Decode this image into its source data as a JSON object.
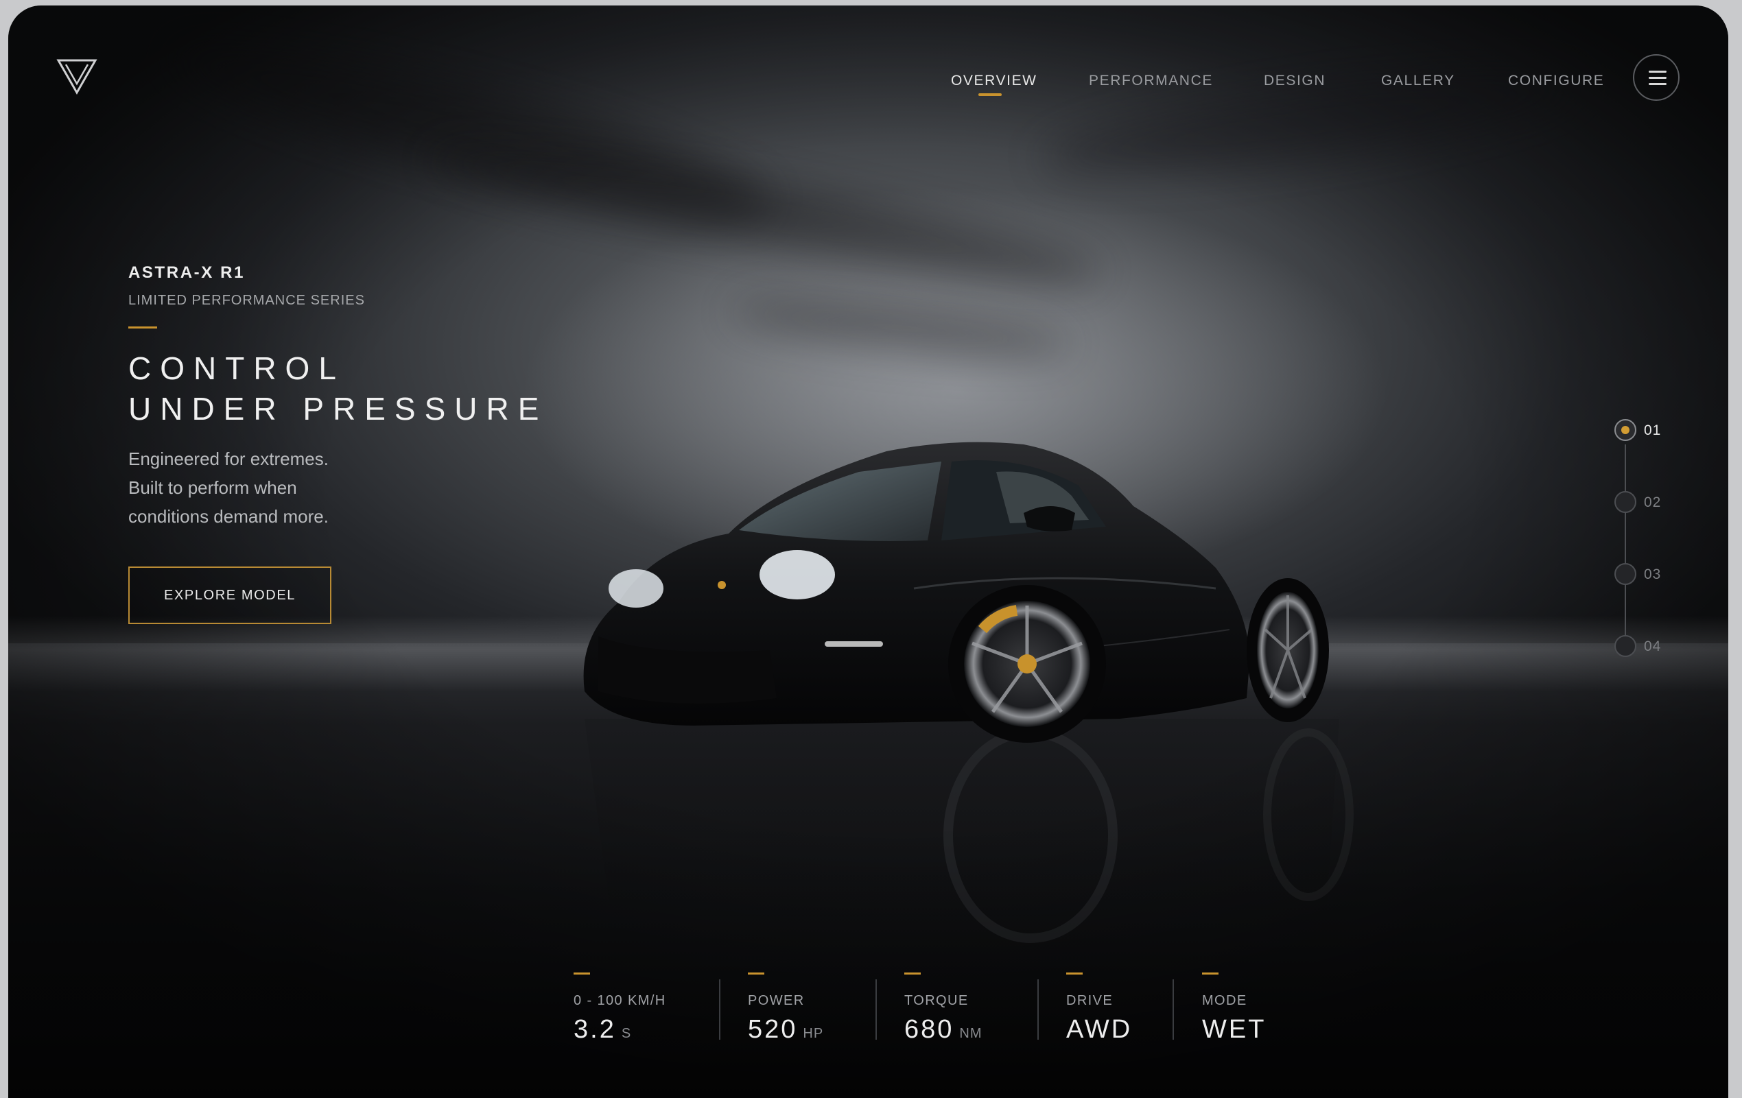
{
  "colors": {
    "accent": "#c9932e",
    "background": "#121315",
    "text": "#f0f0f0"
  },
  "header": {
    "logo_icon": "triangle-logo-icon",
    "nav": [
      {
        "label": "OVERVIEW",
        "active": true
      },
      {
        "label": "PERFORMANCE",
        "active": false
      },
      {
        "label": "DESIGN",
        "active": false
      },
      {
        "label": "GALLERY",
        "active": false
      },
      {
        "label": "CONFIGURE",
        "active": false
      }
    ],
    "menu_icon": "hamburger-menu-icon"
  },
  "hero": {
    "model": "ASTRA-X R1",
    "series": "LIMITED PERFORMANCE SERIES",
    "headline": [
      "CONTROL",
      "UNDER PRESSURE"
    ],
    "description": [
      "Engineered for extremes.",
      "Built to perform when",
      "conditions demand more."
    ],
    "cta_label": "EXPLORE MODEL"
  },
  "stepper": [
    {
      "label": "01",
      "active": true
    },
    {
      "label": "02",
      "active": false
    },
    {
      "label": "03",
      "active": false
    },
    {
      "label": "04",
      "active": false
    }
  ],
  "stats": [
    {
      "label": "0 - 100 KM/H",
      "value": "3.2",
      "unit": "S"
    },
    {
      "label": "POWER",
      "value": "520",
      "unit": "HP"
    },
    {
      "label": "TORQUE",
      "value": "680",
      "unit": "NM"
    },
    {
      "label": "DRIVE",
      "value": "AWD",
      "unit": ""
    },
    {
      "label": "MODE",
      "value": "WET",
      "unit": ""
    }
  ]
}
